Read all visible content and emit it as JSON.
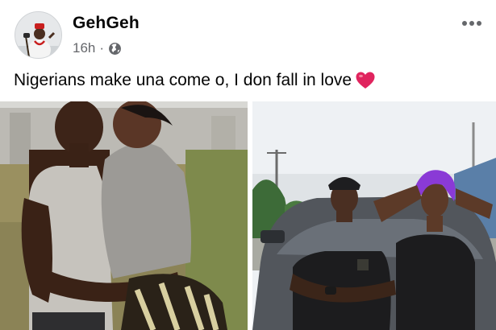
{
  "post": {
    "author": "GehGeh",
    "timestamp": "16h",
    "separator": "·",
    "privacy_icon": "globe-icon",
    "more_icon": "more-options-icon",
    "caption": "Nigerians make una come o, I don fall in love",
    "caption_emoji": "red-heart-icon"
  },
  "photos": [
    {
      "subject": "couple-embracing-kiss-photo"
    },
    {
      "subject": "couple-posing-by-car-photo"
    }
  ],
  "colors": {
    "text": "#050505",
    "secondary_text": "#65676b",
    "heart": "#e0245e",
    "background": "#ffffff"
  }
}
